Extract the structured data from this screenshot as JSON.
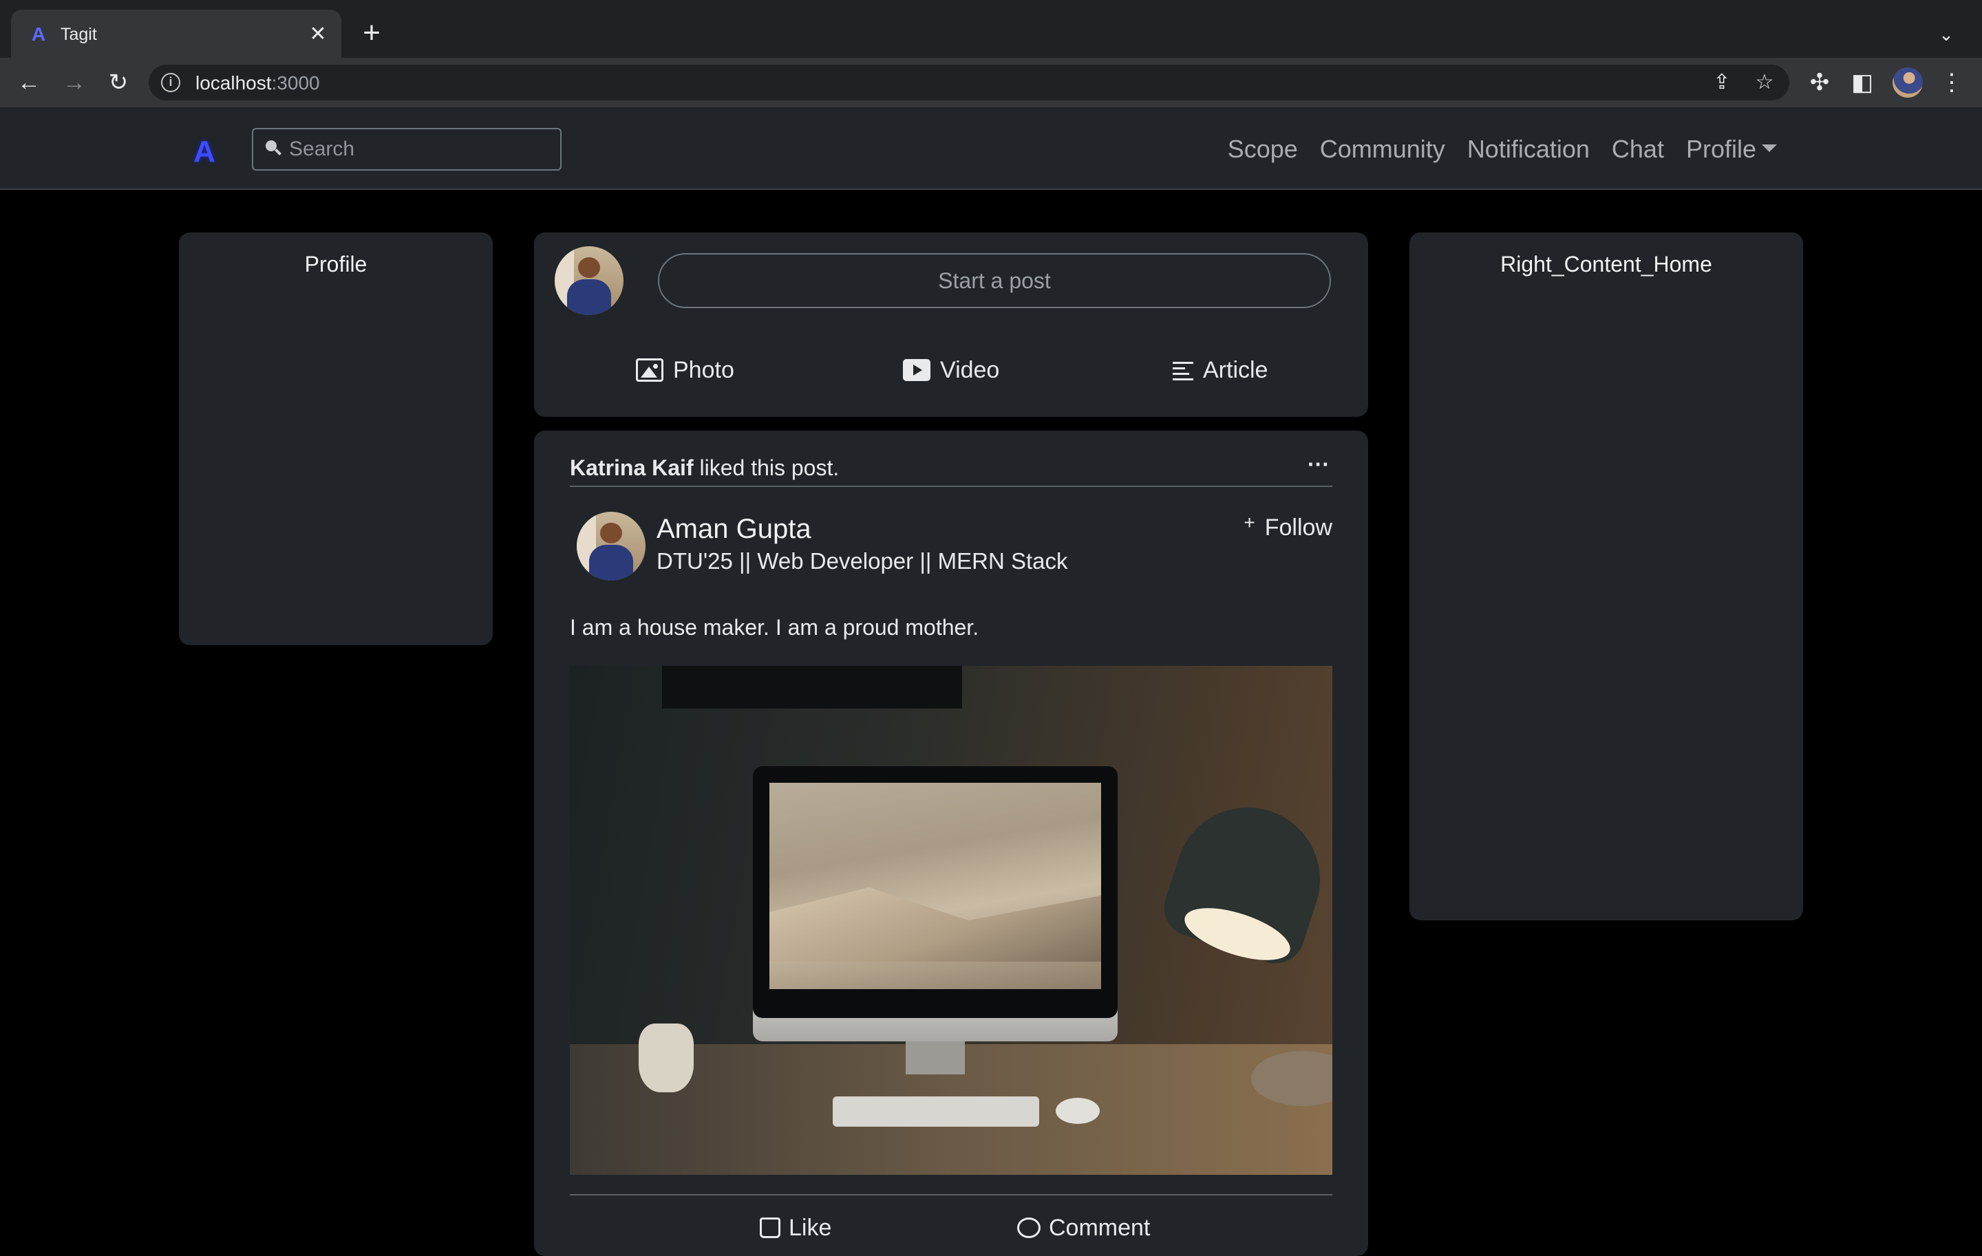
{
  "browser": {
    "tab_title": "Tagit",
    "tab_favicon": "A",
    "url_host": "localhost",
    "url_port": ":3000",
    "icons": [
      "back-icon",
      "forward-icon",
      "reload-icon",
      "site-info-icon",
      "share-icon",
      "bookmark-star-icon",
      "extensions-icon",
      "side-panel-icon",
      "profile-avatar",
      "kebab-menu-icon"
    ]
  },
  "navbar": {
    "brand": "A",
    "search_placeholder": "Search",
    "links": [
      "Scope",
      "Community",
      "Notification",
      "Chat",
      "Profile"
    ]
  },
  "left_panel": {
    "title": "Profile"
  },
  "right_panel": {
    "title": "Right_Content_Home"
  },
  "composer": {
    "start_post": "Start a post",
    "actions": [
      "Photo",
      "Video",
      "Article"
    ]
  },
  "post": {
    "liker": "Katrina Kaif",
    "liked_text": "liked this post.",
    "author": "Aman Gupta",
    "headline": "DTU'25 || Web Developer || MERN Stack",
    "follow_label": "Follow",
    "text": "I am a house maker. I am a proud mother.",
    "image_alt": "desk with monitor and lamp",
    "actions": [
      "Like",
      "Comment"
    ]
  },
  "colors": {
    "page_bg": "#000000",
    "card_bg": "#212529",
    "navbar_bg": "#212529",
    "brand_accent": "#3d4cff"
  }
}
